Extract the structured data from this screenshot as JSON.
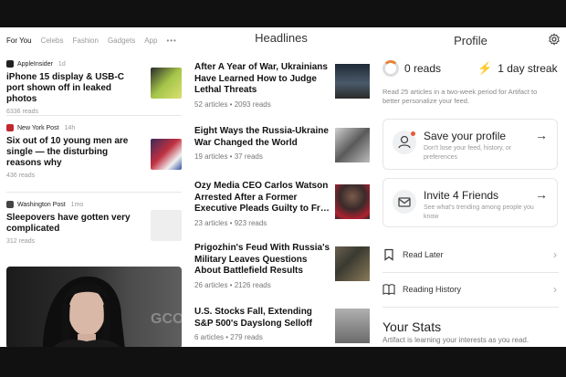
{
  "tabs": [
    {
      "label": "For You",
      "active": true
    },
    {
      "label": "Celebs",
      "active": false
    },
    {
      "label": "Fashion",
      "active": false
    },
    {
      "label": "Gadgets",
      "active": false
    },
    {
      "label": "App",
      "active": false
    }
  ],
  "tabs_more": "•••",
  "feed": [
    {
      "source": "AppleInsider",
      "age": "1d",
      "title": "iPhone 15 display & USB-C port shown off in leaked photos",
      "reads": "6336 reads",
      "logo_color": "#222222",
      "thumb_color": "#c0d060"
    },
    {
      "source": "New York Post",
      "age": "14h",
      "title": "Six out of 10 young men are single — the disturbing reasons why",
      "reads": "436 reads",
      "logo_color": "#c0282d",
      "thumb_color": "#5a4d7a"
    },
    {
      "source": "Washington Post",
      "age": "1mo",
      "title": "Sleepovers have gotten very complicated",
      "reads": "312 reads",
      "logo_color": "#444444",
      "thumb_color": "#eeeeee"
    }
  ],
  "hero_overlay": "GCO",
  "headlines": {
    "title": "Headlines",
    "items": [
      {
        "title": "After A Year of War, Ukrainians Have Learned How to Judge Lethal Threats",
        "meta": "52 articles • 2093 reads",
        "thumb_color": "#2d3a4a"
      },
      {
        "title": "Eight Ways the Russia-Ukraine War Changed the World",
        "meta": "19 articles • 37 reads",
        "thumb_color": "#8a8a8a"
      },
      {
        "title": "Ozy Media CEO Carlos Watson Arrested After a Former Executive Pleads Guilty to Fr…",
        "meta": "23 articles • 923 reads",
        "thumb_color": "#4a3a3a"
      },
      {
        "title": "Prigozhin's Feud With Russia's Military Leaves Questions About Battlefield Results",
        "meta": "26 articles • 2126 reads",
        "thumb_color": "#5a5040"
      },
      {
        "title": "U.S. Stocks Fall, Extending S&P 500's Dayslong Selloff",
        "meta": "6 articles • 279 reads",
        "thumb_color": "#9a9a9a"
      }
    ]
  },
  "profile": {
    "title": "Profile",
    "reads": "0 reads",
    "streak": "1 day streak",
    "description": "Read 25 articles in a two-week period for Artifact to better personalize your feed.",
    "save_title": "Save your profile",
    "save_sub": "Don't lose your feed, history, or preferences",
    "invite_title": "Invite 4 Friends",
    "invite_sub": "See what's trending among people you know",
    "read_later": "Read Later",
    "reading_history": "Reading History",
    "stats_title": "Your Stats",
    "stats_sub": "Artifact is learning your interests as you read."
  },
  "colors": {
    "accent": "#e8843a",
    "notify": "#e55a3a"
  },
  "icons": [
    "gear-icon",
    "bolt-icon",
    "person-icon",
    "mail-icon",
    "arrow-right-icon",
    "bookmark-icon",
    "book-icon",
    "chevron-right-icon"
  ]
}
